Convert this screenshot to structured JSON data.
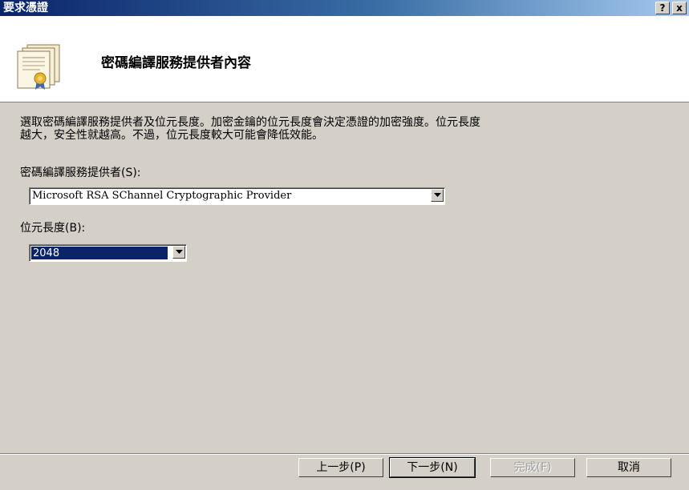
{
  "window": {
    "title": "要求憑證",
    "help_label": "?",
    "close_label": "x"
  },
  "header": {
    "title": "密碼編譯服務提供者內容",
    "icon": "certificate-icon"
  },
  "description": {
    "line1": "選取密碼編譯服務提供者及位元長度。加密金鑰的位元長度會決定憑證的加密強度。位元長度",
    "line2": "越大，安全性就越高。不過，位元長度較大可能會降低效能。"
  },
  "provider": {
    "label": "密碼編譯服務提供者(S):",
    "value": "Microsoft RSA SChannel Cryptographic Provider"
  },
  "bit_length": {
    "label": "位元長度(B):",
    "value": "2048"
  },
  "buttons": {
    "back": "上一步(P)",
    "next": "下一步(N)",
    "finish": "完成(F)",
    "cancel": "取消"
  }
}
